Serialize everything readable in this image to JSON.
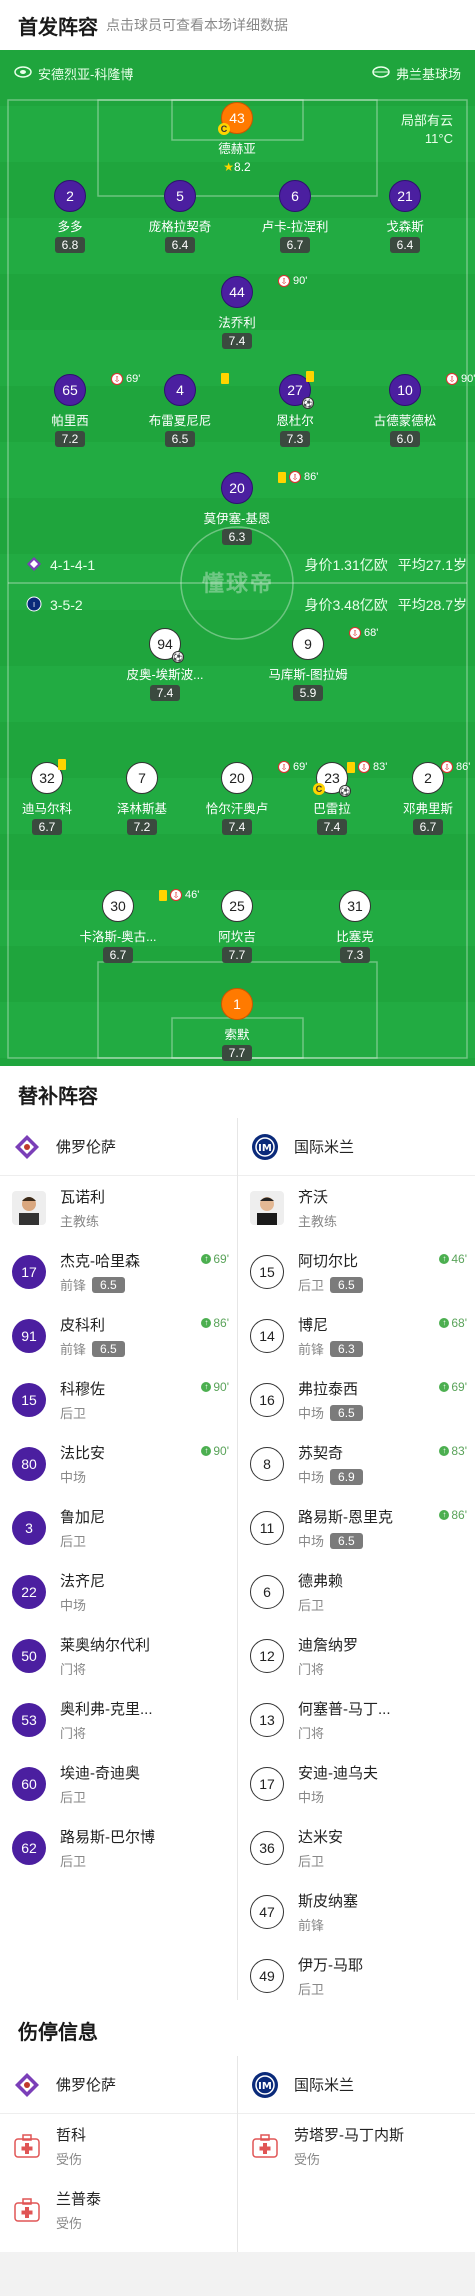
{
  "header": {
    "title": "首发阵容",
    "subtitle": "点击球员可查看本场详细数据"
  },
  "pitch": {
    "venue_team_left": "安德烈亚-科隆博",
    "venue_team_right": "弗兰基球场",
    "weather": "局部有云",
    "temperature": "11°C",
    "watermark": "懂球帝",
    "home_formation": "4-1-4-1",
    "home_value": "身价1.31亿欧",
    "home_age": "平均27.1岁",
    "away_formation": "3-5-2",
    "away_value": "身价3.48亿欧",
    "away_age": "平均28.7岁"
  },
  "home_players": [
    {
      "num": "43",
      "name": "德赫亚",
      "rating": "8.2",
      "gk": true,
      "captain": true,
      "star": true
    },
    {
      "num": "2",
      "name": "多多",
      "rating": "6.8"
    },
    {
      "num": "5",
      "name": "庞格拉契奇",
      "rating": "6.4"
    },
    {
      "num": "6",
      "name": "卢卡-拉涅利",
      "rating": "6.7"
    },
    {
      "num": "21",
      "name": "戈森斯",
      "rating": "6.4"
    },
    {
      "num": "44",
      "name": "法乔利",
      "rating": "7.4",
      "sub": "90'"
    },
    {
      "num": "65",
      "name": "帕里西",
      "rating": "7.2",
      "sub": "69'"
    },
    {
      "num": "4",
      "name": "布雷夏尼尼",
      "rating": "6.5",
      "yellow": true
    },
    {
      "num": "27",
      "name": "恩杜尔",
      "rating": "7.3",
      "yellow": true,
      "goal": true
    },
    {
      "num": "10",
      "name": "古德蒙德松",
      "rating": "6.0",
      "sub": "90'"
    },
    {
      "num": "20",
      "name": "莫伊塞-基恩",
      "rating": "6.3",
      "yellow": true,
      "sub": "86'"
    }
  ],
  "away_players": [
    {
      "num": "94",
      "name": "皮奥-埃斯波...",
      "rating": "7.4",
      "goal": true
    },
    {
      "num": "9",
      "name": "马库斯-图拉姆",
      "rating": "5.9",
      "sub": "68'"
    },
    {
      "num": "32",
      "name": "迪马尔科",
      "rating": "6.7",
      "yellow": true
    },
    {
      "num": "7",
      "name": "泽林斯基",
      "rating": "7.2"
    },
    {
      "num": "20",
      "name": "恰尔汗奥卢",
      "rating": "7.4",
      "sub": "69'"
    },
    {
      "num": "23",
      "name": "巴雷拉",
      "rating": "7.4",
      "yellow": true,
      "sub": "83'",
      "captain": true,
      "goal": true
    },
    {
      "num": "2",
      "name": "邓弗里斯",
      "rating": "6.7",
      "sub": "86'"
    },
    {
      "num": "30",
      "name": "卡洛斯-奥古...",
      "rating": "6.7",
      "yellow": true,
      "sub": "46'"
    },
    {
      "num": "25",
      "name": "阿坎吉",
      "rating": "7.7"
    },
    {
      "num": "31",
      "name": "比塞克",
      "rating": "7.3"
    },
    {
      "num": "1",
      "name": "索默",
      "rating": "7.7",
      "gk": true
    }
  ],
  "subs": {
    "title": "替补阵容",
    "home_team": "佛罗伦萨",
    "away_team": "国际米兰",
    "home_coach": {
      "name": "瓦诺利",
      "role": "主教练"
    },
    "away_coach": {
      "name": "齐沃",
      "role": "主教练"
    },
    "home": [
      {
        "num": "17",
        "name": "杰克-哈里森",
        "pos": "前锋",
        "rating": "6.5",
        "in": "69'"
      },
      {
        "num": "91",
        "name": "皮科利",
        "pos": "前锋",
        "rating": "6.5",
        "in": "86'"
      },
      {
        "num": "15",
        "name": "科穆佐",
        "pos": "后卫",
        "in": "90'"
      },
      {
        "num": "80",
        "name": "法比安",
        "pos": "中场",
        "in": "90'"
      },
      {
        "num": "3",
        "name": "鲁加尼",
        "pos": "后卫"
      },
      {
        "num": "22",
        "name": "法齐尼",
        "pos": "中场"
      },
      {
        "num": "50",
        "name": "莱奥纳尔代利",
        "pos": "门将"
      },
      {
        "num": "53",
        "name": "奥利弗-克里...",
        "pos": "门将"
      },
      {
        "num": "60",
        "name": "埃迪-奇迪奥",
        "pos": "后卫"
      },
      {
        "num": "62",
        "name": "路易斯-巴尔博",
        "pos": "后卫"
      }
    ],
    "away": [
      {
        "num": "15",
        "name": "阿切尔比",
        "pos": "后卫",
        "rating": "6.5",
        "in": "46'"
      },
      {
        "num": "14",
        "name": "博尼",
        "pos": "前锋",
        "rating": "6.3",
        "in": "68'"
      },
      {
        "num": "16",
        "name": "弗拉泰西",
        "pos": "中场",
        "rating": "6.5",
        "in": "69'"
      },
      {
        "num": "8",
        "name": "苏契奇",
        "pos": "中场",
        "rating": "6.9",
        "in": "83'"
      },
      {
        "num": "11",
        "name": "路易斯-恩里克",
        "pos": "中场",
        "rating": "6.5",
        "in": "86'"
      },
      {
        "num": "6",
        "name": "德弗赖",
        "pos": "后卫"
      },
      {
        "num": "12",
        "name": "迪詹纳罗",
        "pos": "门将"
      },
      {
        "num": "13",
        "name": "何塞普-马丁...",
        "pos": "门将"
      },
      {
        "num": "17",
        "name": "安迪-迪乌夫",
        "pos": "中场"
      },
      {
        "num": "36",
        "name": "达米安",
        "pos": "后卫"
      },
      {
        "num": "47",
        "name": "斯皮纳塞",
        "pos": "前锋"
      },
      {
        "num": "49",
        "name": "伊万-马耶",
        "pos": "后卫"
      }
    ]
  },
  "injuries": {
    "title": "伤停信息",
    "home_team": "佛罗伦萨",
    "away_team": "国际米兰",
    "home": [
      {
        "name": "哲科",
        "status": "受伤"
      },
      {
        "name": "兰普泰",
        "status": "受伤"
      }
    ],
    "away": [
      {
        "name": "劳塔罗-马丁内斯",
        "status": "受伤"
      }
    ]
  }
}
